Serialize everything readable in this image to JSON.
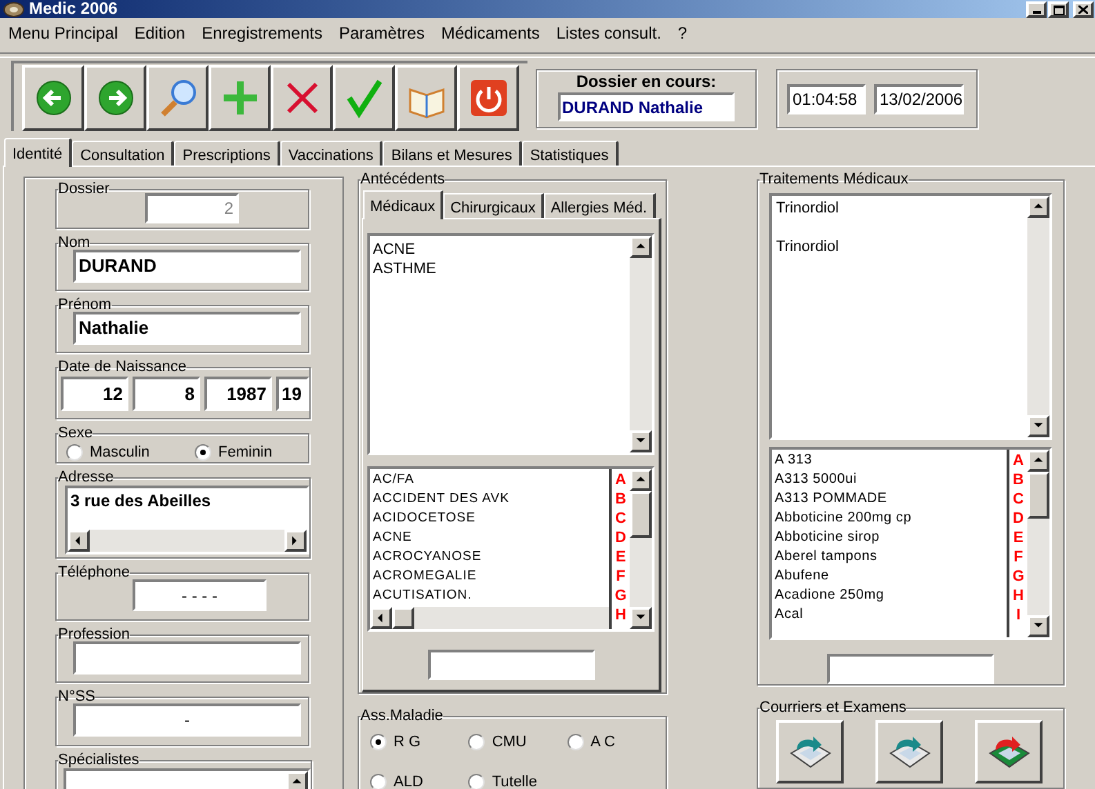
{
  "window": {
    "title": "Medic 2006"
  },
  "menu": [
    "Menu Principal",
    "Edition",
    "Enregistrements",
    "Paramètres",
    "Médicaments",
    "Listes consult.",
    "?"
  ],
  "current_record": {
    "label": "Dossier en cours:",
    "value": "DURAND Nathalie"
  },
  "clock": {
    "time": "01:04:58",
    "date": "13/02/2006"
  },
  "tabs": [
    {
      "label": "Identité",
      "selected": true
    },
    {
      "label": "Consultation",
      "selected": false
    },
    {
      "label": "Prescriptions",
      "selected": false
    },
    {
      "label": "Vaccinations",
      "selected": false
    },
    {
      "label": "Bilans et Mesures",
      "selected": false
    },
    {
      "label": "Statistiques",
      "selected": false
    }
  ],
  "identity": [
    {
      "kind": "record",
      "label": "Dossier",
      "value": "2",
      "disabled": true
    },
    {
      "kind": "text",
      "label": "Nom",
      "value": "DURAND"
    },
    {
      "kind": "text",
      "label": "Prénom",
      "value": "Nathalie"
    },
    {
      "kind": "date",
      "label": "Date de Naissance",
      "parts": [
        "12",
        "8",
        "1987",
        "19"
      ]
    },
    {
      "kind": "choice",
      "label": "Sexe",
      "options": [
        {
          "label": "Masculin",
          "selected": false
        },
        {
          "label": "Feminin",
          "selected": true
        }
      ]
    },
    {
      "kind": "memo",
      "label": "Adresse",
      "value": "3 rue des Abeilles"
    },
    {
      "kind": "phone",
      "label": "Téléphone",
      "value": "- - - -"
    },
    {
      "kind": "text",
      "label": "Profession"
    },
    {
      "kind": "number",
      "label": "N°SS",
      "value": "-"
    },
    {
      "kind": "list",
      "label": "Spécialistes"
    }
  ],
  "antecedents": {
    "title": "Antécédents",
    "tabs": [
      {
        "label": "Médicaux",
        "selected": true
      },
      {
        "label": "Chirurgicaux",
        "selected": false
      },
      {
        "label": "Allergies Méd.",
        "selected": false
      }
    ],
    "entries": [
      "ACNE",
      "ASTHME"
    ],
    "catalog": [
      "AC/FA",
      "ACCIDENT DES AVK",
      "ACIDOCETOSE",
      "ACNE",
      "ACROCYANOSE",
      "ACROMEGALIE",
      "ACUTISATION."
    ],
    "letters": [
      "A",
      "B",
      "C",
      "D",
      "E",
      "F",
      "G",
      "H"
    ]
  },
  "insurance": {
    "title": "Ass.Maladie",
    "options": [
      {
        "label": "R G",
        "selected": true
      },
      {
        "label": "CMU",
        "selected": false
      },
      {
        "label": "A C",
        "selected": false
      },
      {
        "label": "ALD",
        "selected": false
      },
      {
        "label": "Tutelle",
        "selected": false
      }
    ]
  },
  "treatments": {
    "title": "Traitements Médicaux",
    "entries": [
      "Trinordiol",
      "Trinordiol"
    ],
    "catalog": [
      "A 313",
      "A313 5000ui",
      "A313 POMMADE",
      "Abboticine 200mg cp",
      "Abboticine sirop",
      "Aberel tampons",
      "Abufene",
      "Acadione 250mg",
      "Acal"
    ],
    "letters": [
      "A",
      "B",
      "C",
      "D",
      "E",
      "F",
      "G",
      "H",
      "I"
    ]
  },
  "documents": {
    "title": "Courriers et Examens"
  }
}
